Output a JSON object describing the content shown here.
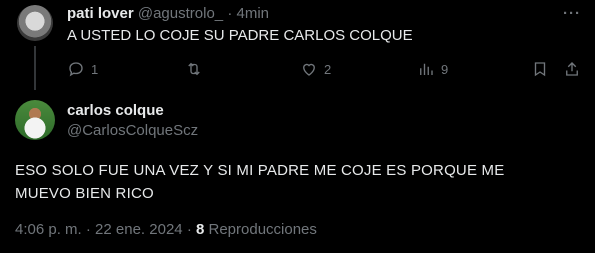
{
  "reply": {
    "display_name": "pati lover",
    "handle": "@agustrolo_",
    "separator": "·",
    "time": "4min",
    "text": "A USTED LO COJE SU PADRE CARLOS COLQUE",
    "actions": {
      "replies": "1",
      "retweets": "",
      "likes": "2",
      "views": "9"
    },
    "icons": [
      "reply-icon",
      "retweet-icon",
      "like-icon",
      "views-icon",
      "bookmark-icon",
      "share-icon",
      "more-icon"
    ]
  },
  "main": {
    "display_name": "carlos colque",
    "handle": "@CarlosColqueScz",
    "text": "ESO SOLO FUE UNA VEZ Y SI MI PADRE ME COJE ES PORQUE ME MUEVO BIEN RICO",
    "time": "4:06 p. m.",
    "date": "22 ene. 2024",
    "separator": "·",
    "views_count": "8",
    "views_label": "Reproducciones"
  },
  "colors": {
    "background": "#000000",
    "text": "#e7e9ea",
    "muted": "#71767b",
    "line": "#333639"
  }
}
